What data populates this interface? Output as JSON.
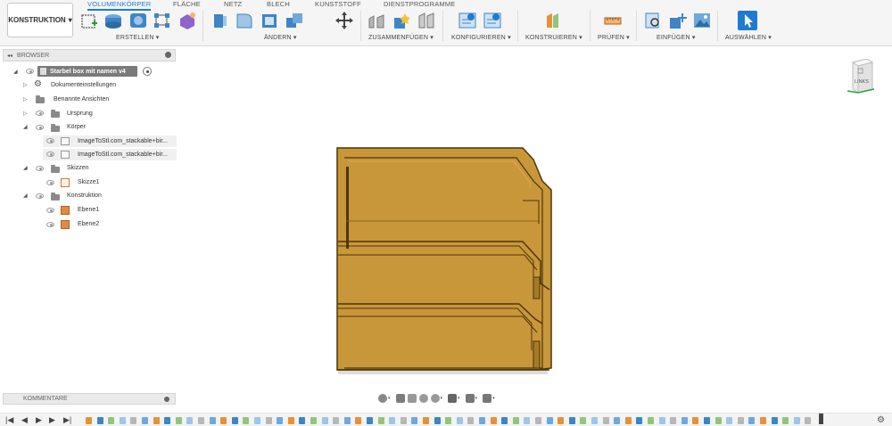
{
  "workspace": {
    "label": "KONSTRUKTION",
    "chevron": "▾"
  },
  "tabs": [
    {
      "label": "VOLUMENKÖRPER",
      "active": true
    },
    {
      "label": "FLÄCHE"
    },
    {
      "label": "NETZ"
    },
    {
      "label": "BLECH"
    },
    {
      "label": "KUNSTSTOFF"
    },
    {
      "label": "DIENSTPROGRAMME"
    }
  ],
  "toolbar_groups": [
    {
      "label": "ERSTELLEN ▾",
      "tools": [
        "sketch-icon",
        "extrude-icon",
        "revolve-icon",
        "pattern-icon",
        "form-icon"
      ]
    },
    {
      "label": "ÄNDERN ▾",
      "tools": [
        "press-pull-icon",
        "fillet-icon",
        "shell-icon",
        "combine-icon",
        "move-icon"
      ]
    },
    {
      "label": "ZUSAMMENFÜGEN ▾",
      "tools": [
        "joint-icon",
        "new-component-icon",
        "as-built-joint-icon"
      ]
    },
    {
      "label": "KONFIGURIEREN ▾",
      "tools": [
        "configure-icon",
        "parameters-icon"
      ]
    },
    {
      "label": "KONSTRUIEREN ▾",
      "tools": [
        "construct-plane-icon"
      ]
    },
    {
      "label": "PRÜFEN ▾",
      "tools": [
        "measure-icon"
      ]
    },
    {
      "label": "EINFÜGEN ▾",
      "tools": [
        "insert-derive-icon",
        "insert-mesh-icon",
        "insert-canvas-icon"
      ]
    },
    {
      "label": "AUSWÄHLEN ▾",
      "tools": [
        "select-icon"
      ]
    }
  ],
  "browser": {
    "title": "BROWSER",
    "collapse_glyph": "◂◂",
    "root": "Starbel box mit namen v4",
    "items": [
      {
        "label": "Dokumenteinstellungen"
      },
      {
        "label": "Benannte Ansichten"
      },
      {
        "label": "Ursprung"
      },
      {
        "label": "Körper"
      },
      {
        "label": "ImageToStl.com_stackable+bir..."
      },
      {
        "label": "ImageToStl.com_stackable+bir..."
      },
      {
        "label": "Skizzen"
      },
      {
        "label": "Skizze1"
      },
      {
        "label": "Konstruktion"
      },
      {
        "label": "Ebene1"
      },
      {
        "label": "Ebene2"
      }
    ]
  },
  "comments": {
    "title": "KOMMENTARE"
  },
  "viewcube": {
    "face_label": "LINKS"
  },
  "colors": {
    "accent": "#1f7bd1",
    "model_fill": "#c8973a",
    "model_dark": "#6f4e14",
    "model_light": "#d9ad55"
  },
  "timeline": {
    "controls": [
      "first-icon",
      "prev-icon",
      "play-icon",
      "next-icon",
      "last-icon"
    ],
    "glyphs": {
      "first": "|◀",
      "prev": "◀",
      "play": "▶",
      "next": "▶",
      "last": "▶|",
      "gear": "⚙"
    }
  }
}
